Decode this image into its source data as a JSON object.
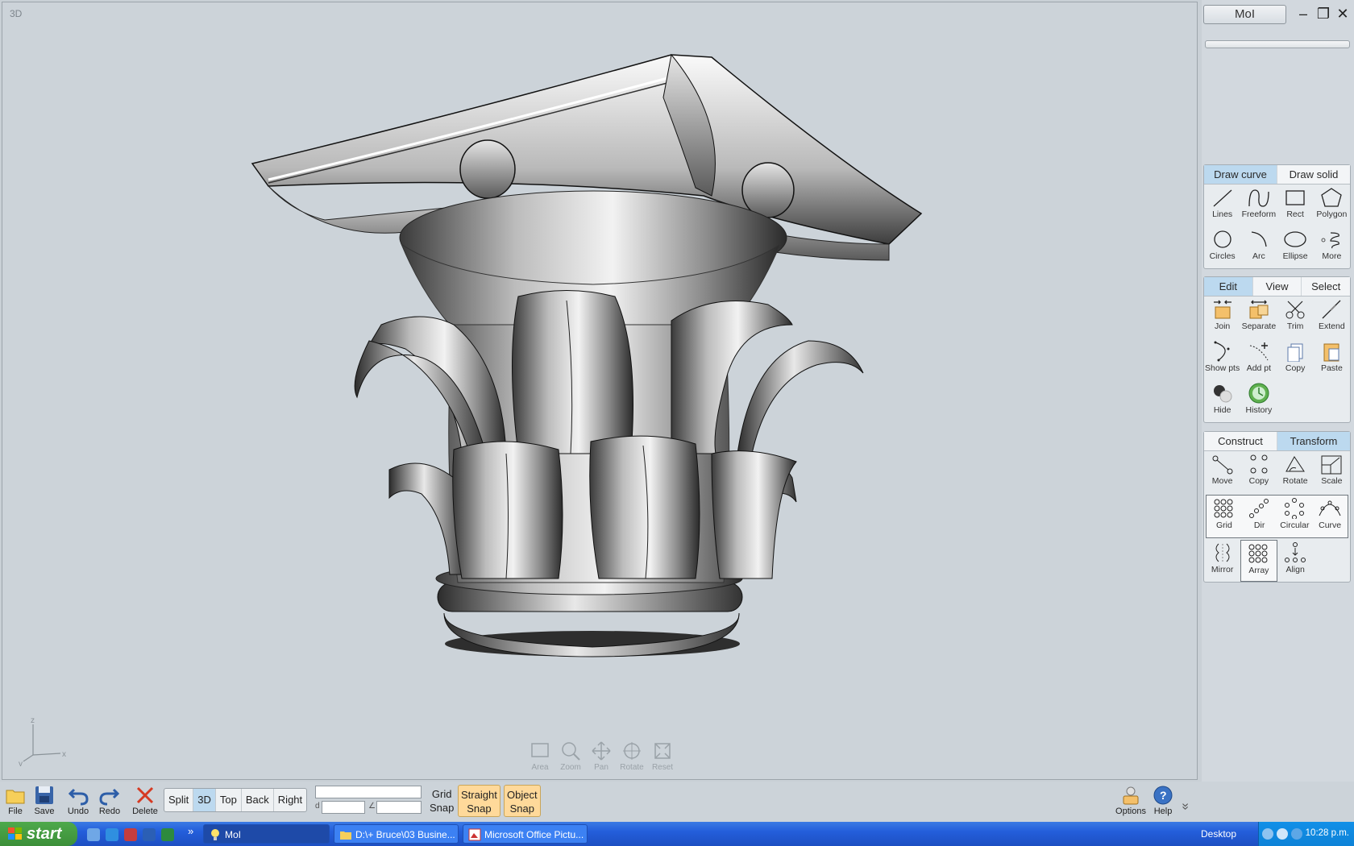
{
  "viewport": {
    "label": "3D",
    "axes": {
      "z": "z",
      "y": "y",
      "x": "x"
    },
    "nav": [
      {
        "name": "area-icon",
        "label": "Area"
      },
      {
        "name": "zoom-icon",
        "label": "Zoom"
      },
      {
        "name": "pan-icon",
        "label": "Pan"
      },
      {
        "name": "rotate-icon",
        "label": "Rotate"
      },
      {
        "name": "reset-icon",
        "label": "Reset"
      }
    ]
  },
  "panel": {
    "title": "MoI",
    "window_controls": {
      "minimize": "–",
      "maximize": "❐",
      "close": "✕"
    },
    "draw_tabs": [
      "Draw curve",
      "Draw solid"
    ],
    "draw_tools": [
      "Lines",
      "Freeform",
      "Rect",
      "Polygon",
      "Circles",
      "Arc",
      "Ellipse",
      "More"
    ],
    "edit_tabs": [
      "Edit",
      "View",
      "Select"
    ],
    "edit_tools": [
      "Join",
      "Separate",
      "Trim",
      "Extend",
      "Show pts",
      "Add pt",
      "Copy",
      "Paste",
      "Hide",
      "History"
    ],
    "transform_tabs": [
      "Construct",
      "Transform"
    ],
    "transform_tools": [
      "Move",
      "Copy",
      "Rotate",
      "Scale"
    ],
    "array_tools": [
      "Grid",
      "Dir",
      "Circular",
      "Curve"
    ],
    "extra_tools": [
      "Mirror",
      "Array",
      "Align"
    ]
  },
  "bottom": {
    "file": "File",
    "save": "Save",
    "undo": "Undo",
    "redo": "Redo",
    "delete": "Delete",
    "views": [
      "Split",
      "3D",
      "Top",
      "Back",
      "Right"
    ],
    "active_view": "3D",
    "distance_symbol": "d",
    "angle_symbol": "∠",
    "grid_snap": {
      "line1": "Grid",
      "line2": "Snap"
    },
    "straight_snap": {
      "line1": "Straight",
      "line2": "Snap"
    },
    "object_snap": {
      "line1": "Object",
      "line2": "Snap"
    },
    "options": "Options",
    "help": "Help",
    "help_glyph": "?",
    "more_glyph": "»"
  },
  "taskbar": {
    "start": "start",
    "tasks": [
      "MoI",
      "D:\\+ Bruce\\03 Busine...",
      "Microsoft Office Pictu..."
    ],
    "desktop": "Desktop",
    "clock": "10:28 p.m."
  },
  "colors": {
    "tab_active": "#bcd9ef",
    "snap_on": "#ffd99a",
    "taskbar": "#245edb",
    "start": "#3c8f39"
  }
}
